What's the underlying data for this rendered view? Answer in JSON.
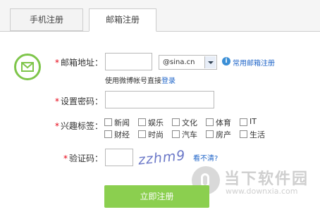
{
  "tabs": [
    "手机注册",
    "邮箱注册"
  ],
  "form": {
    "email_label": "邮箱地址：",
    "email_value": "",
    "domain_selected": "@sina.cn",
    "common_email_link": "常用邮箱注册",
    "weibo_hint": "使用微博帐号直接",
    "login_link": "登录",
    "password_label": "设置密码：",
    "interests_label": "兴趣标签：",
    "interests": [
      "新闻",
      "娱乐",
      "文化",
      "体育",
      "IT",
      "财经",
      "时尚",
      "汽车",
      "房产",
      "生活"
    ],
    "captcha_label": "验证码：",
    "captcha_text": "zzhm9",
    "refresh_link": "看不清?",
    "required_mark": "*",
    "submit_label": "立即注册"
  },
  "watermark": {
    "brand": "当下软件园",
    "url": "www.downxia.com"
  },
  "colors": {
    "accent_green": "#8bcf4f",
    "link_blue": "#2267c9",
    "required_red": "#e60012"
  }
}
